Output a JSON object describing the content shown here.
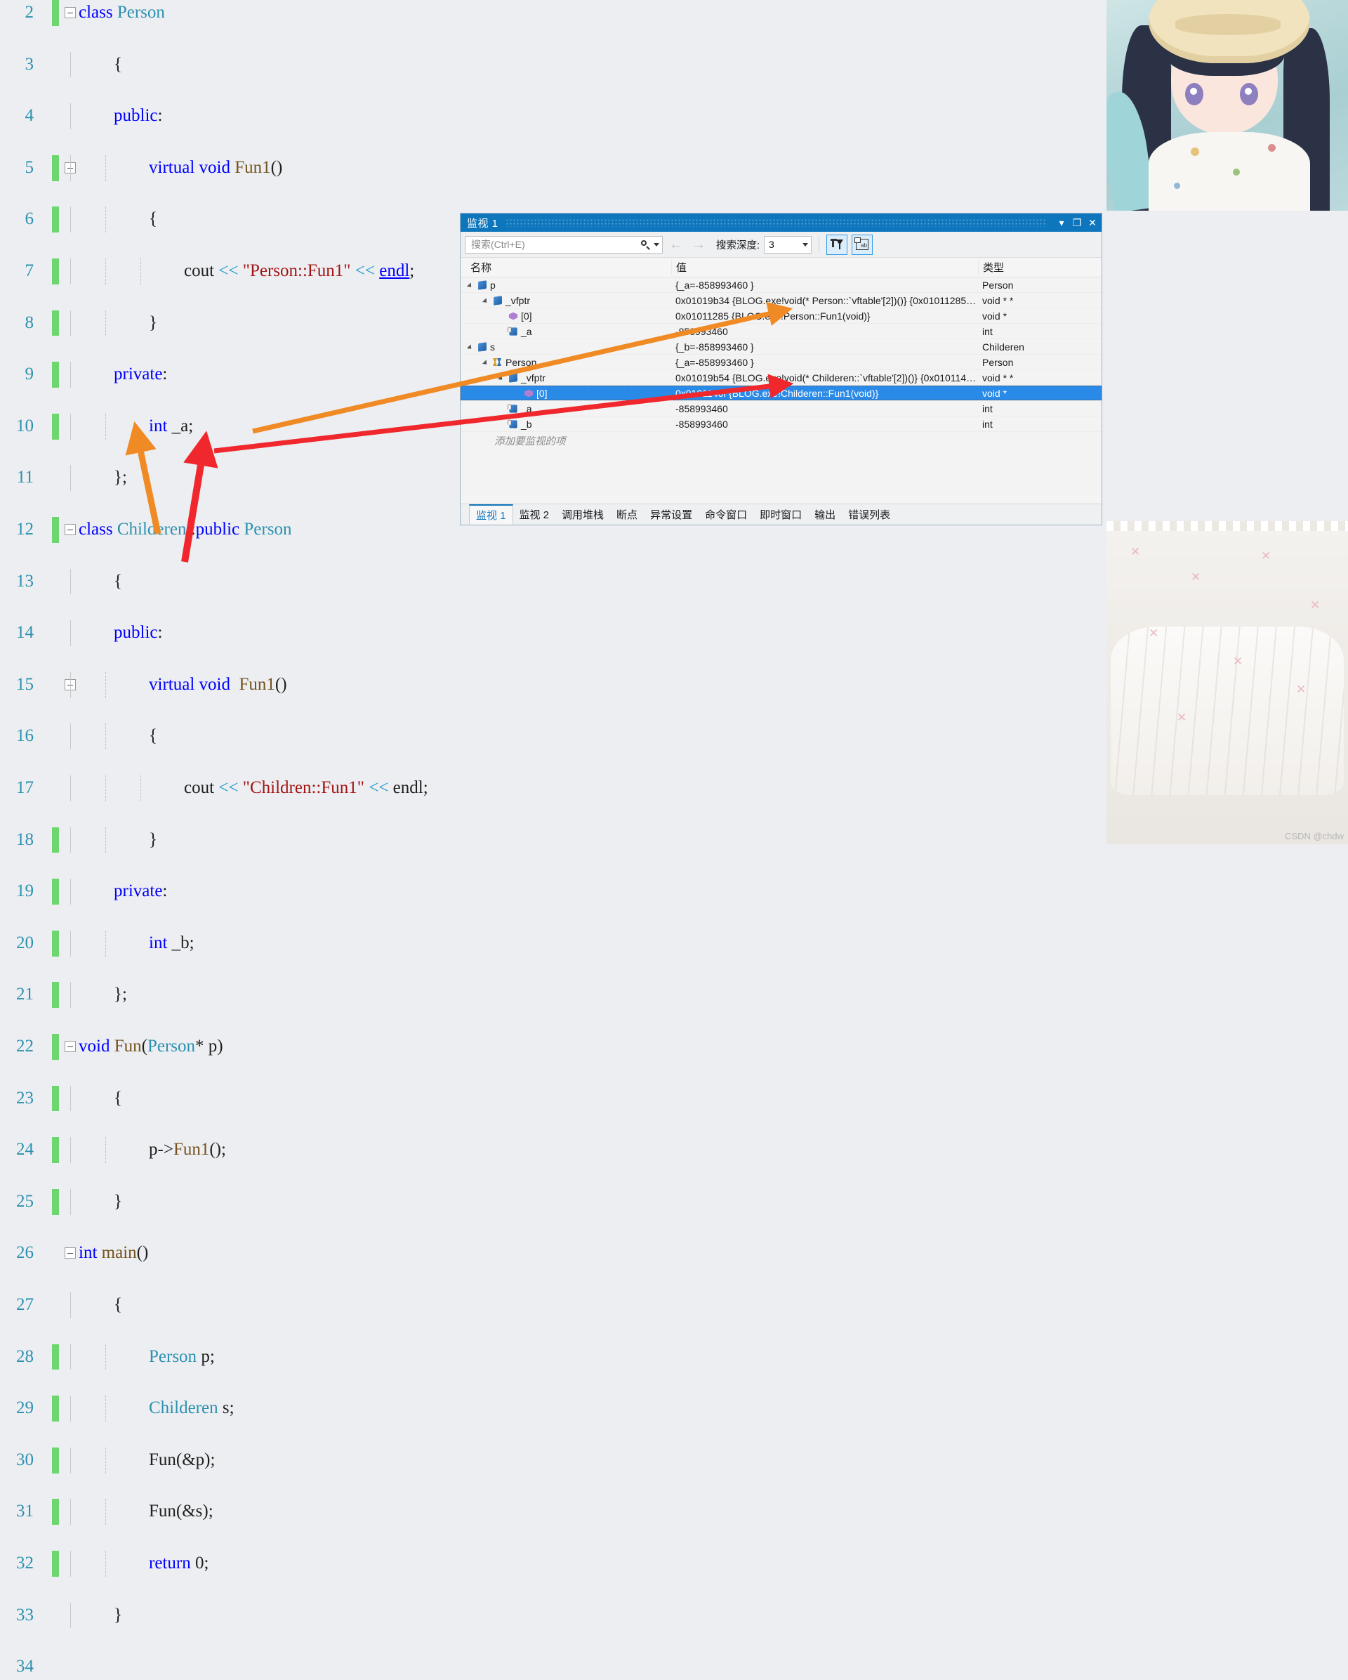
{
  "editor": {
    "first_line_number": 2,
    "lines": [
      {
        "n": 2,
        "fold": true,
        "change": true,
        "indent": 0,
        "tokens": [
          {
            "t": "class ",
            "c": "kw"
          },
          {
            "t": "Person",
            "c": "type"
          }
        ]
      },
      {
        "n": 3,
        "fold": false,
        "change": false,
        "indent": 1,
        "tokens": [
          {
            "t": "{",
            "c": "pl"
          }
        ]
      },
      {
        "n": 4,
        "fold": false,
        "change": false,
        "indent": 1,
        "tokens": [
          {
            "t": "public",
            "c": "kw"
          },
          {
            "t": ":",
            "c": "pl"
          }
        ]
      },
      {
        "n": 5,
        "fold": true,
        "change": true,
        "indent": 2,
        "tokens": [
          {
            "t": "virtual void ",
            "c": "kw"
          },
          {
            "t": "Fun1",
            "c": "fn"
          },
          {
            "t": "()",
            "c": "pl"
          }
        ]
      },
      {
        "n": 6,
        "fold": false,
        "change": true,
        "indent": 2,
        "tokens": [
          {
            "t": "{",
            "c": "pl"
          }
        ]
      },
      {
        "n": 7,
        "fold": false,
        "change": true,
        "indent": 3,
        "tokens": [
          {
            "t": "cout ",
            "c": "ident"
          },
          {
            "t": "<< ",
            "c": "op"
          },
          {
            "t": "\"Person::Fun1\"",
            "c": "str"
          },
          {
            "t": " << ",
            "c": "op"
          },
          {
            "t": "endl",
            "c": "ul"
          },
          {
            "t": ";",
            "c": "pl"
          }
        ]
      },
      {
        "n": 8,
        "fold": false,
        "change": true,
        "indent": 2,
        "tokens": [
          {
            "t": "}",
            "c": "pl"
          }
        ]
      },
      {
        "n": 9,
        "fold": false,
        "change": true,
        "indent": 1,
        "tokens": [
          {
            "t": "private",
            "c": "kw"
          },
          {
            "t": ":",
            "c": "pl"
          }
        ]
      },
      {
        "n": 10,
        "fold": false,
        "change": true,
        "indent": 2,
        "tokens": [
          {
            "t": "int ",
            "c": "kw"
          },
          {
            "t": "_a;",
            "c": "pl"
          }
        ]
      },
      {
        "n": 11,
        "fold": false,
        "change": false,
        "indent": 1,
        "tokens": [
          {
            "t": "};",
            "c": "pl"
          }
        ]
      },
      {
        "n": 12,
        "fold": true,
        "change": true,
        "indent": 0,
        "tokens": [
          {
            "t": "class ",
            "c": "kw"
          },
          {
            "t": "Childeren",
            "c": "type"
          },
          {
            "t": " :",
            "c": "pl"
          },
          {
            "t": "public ",
            "c": "kw"
          },
          {
            "t": "Person",
            "c": "type"
          }
        ]
      },
      {
        "n": 13,
        "fold": false,
        "change": false,
        "indent": 1,
        "tokens": [
          {
            "t": "{",
            "c": "pl"
          }
        ]
      },
      {
        "n": 14,
        "fold": false,
        "change": false,
        "indent": 1,
        "tokens": [
          {
            "t": "public",
            "c": "kw"
          },
          {
            "t": ":",
            "c": "pl"
          }
        ]
      },
      {
        "n": 15,
        "fold": true,
        "change": false,
        "indent": 2,
        "tokens": [
          {
            "t": "virtual void ",
            "c": "kw"
          },
          {
            "t": " Fun1",
            "c": "fn"
          },
          {
            "t": "()",
            "c": "pl"
          }
        ]
      },
      {
        "n": 16,
        "fold": false,
        "change": false,
        "indent": 2,
        "tokens": [
          {
            "t": "{",
            "c": "pl"
          }
        ]
      },
      {
        "n": 17,
        "fold": false,
        "change": false,
        "indent": 3,
        "tokens": [
          {
            "t": "cout ",
            "c": "ident"
          },
          {
            "t": "<< ",
            "c": "op"
          },
          {
            "t": "\"Children::Fun1\"",
            "c": "str"
          },
          {
            "t": " << ",
            "c": "op"
          },
          {
            "t": "endl",
            "c": "ident"
          },
          {
            "t": ";",
            "c": "pl"
          }
        ]
      },
      {
        "n": 18,
        "fold": false,
        "change": true,
        "indent": 2,
        "tokens": [
          {
            "t": "}",
            "c": "pl"
          }
        ]
      },
      {
        "n": 19,
        "fold": false,
        "change": true,
        "indent": 1,
        "tokens": [
          {
            "t": "private",
            "c": "kw"
          },
          {
            "t": ":",
            "c": "pl"
          }
        ]
      },
      {
        "n": 20,
        "fold": false,
        "change": true,
        "indent": 2,
        "tokens": [
          {
            "t": "int ",
            "c": "kw"
          },
          {
            "t": "_b;",
            "c": "pl"
          }
        ]
      },
      {
        "n": 21,
        "fold": false,
        "change": true,
        "indent": 1,
        "tokens": [
          {
            "t": "};",
            "c": "pl"
          }
        ]
      },
      {
        "n": 22,
        "fold": true,
        "change": true,
        "indent": 0,
        "tokens": [
          {
            "t": "void ",
            "c": "kw"
          },
          {
            "t": "Fun",
            "c": "fn"
          },
          {
            "t": "(",
            "c": "pl"
          },
          {
            "t": "Person",
            "c": "type"
          },
          {
            "t": "* ",
            "c": "pl"
          },
          {
            "t": "p)",
            "c": "pl"
          }
        ]
      },
      {
        "n": 23,
        "fold": false,
        "change": true,
        "indent": 1,
        "tokens": [
          {
            "t": "{",
            "c": "pl"
          }
        ]
      },
      {
        "n": 24,
        "fold": false,
        "change": true,
        "indent": 2,
        "tokens": [
          {
            "t": "p->",
            "c": "ident"
          },
          {
            "t": "Fun1",
            "c": "fn"
          },
          {
            "t": "();",
            "c": "pl"
          }
        ]
      },
      {
        "n": 25,
        "fold": false,
        "change": true,
        "indent": 1,
        "tokens": [
          {
            "t": "}",
            "c": "pl"
          }
        ]
      },
      {
        "n": 26,
        "fold": true,
        "change": false,
        "indent": 0,
        "tokens": [
          {
            "t": "int ",
            "c": "kw"
          },
          {
            "t": "main",
            "c": "fn"
          },
          {
            "t": "()",
            "c": "pl"
          }
        ]
      },
      {
        "n": 27,
        "fold": false,
        "change": false,
        "indent": 1,
        "tokens": [
          {
            "t": "{",
            "c": "pl"
          }
        ]
      },
      {
        "n": 28,
        "fold": false,
        "change": true,
        "indent": 2,
        "tokens": [
          {
            "t": "Person",
            "c": "type"
          },
          {
            "t": " p;",
            "c": "pl"
          }
        ]
      },
      {
        "n": 29,
        "fold": false,
        "change": true,
        "indent": 2,
        "tokens": [
          {
            "t": "Childeren",
            "c": "type"
          },
          {
            "t": " s;",
            "c": "pl"
          }
        ]
      },
      {
        "n": 30,
        "fold": false,
        "change": true,
        "indent": 2,
        "tokens": [
          {
            "t": "Fun",
            "c": "ident"
          },
          {
            "t": "(&p);",
            "c": "pl"
          }
        ]
      },
      {
        "n": 31,
        "fold": false,
        "change": true,
        "indent": 2,
        "tokens": [
          {
            "t": "Fun",
            "c": "ident"
          },
          {
            "t": "(&s);",
            "c": "pl"
          }
        ]
      },
      {
        "n": 32,
        "fold": false,
        "change": true,
        "indent": 2,
        "tokens": [
          {
            "t": "return ",
            "c": "kw"
          },
          {
            "t": "0;",
            "c": "pl"
          }
        ]
      },
      {
        "n": 33,
        "fold": false,
        "change": false,
        "indent": 1,
        "tokens": [
          {
            "t": "}",
            "c": "pl"
          }
        ]
      },
      {
        "n": 34,
        "fold": false,
        "change": false,
        "indent": 0,
        "tokens": []
      }
    ]
  },
  "watch": {
    "title": "监视 1",
    "window_buttons": {
      "dropdown": "▾",
      "maximize": "❐",
      "close": "✕"
    },
    "toolbar": {
      "search_placeholder": "搜索(Ctrl+E)",
      "search_value": "",
      "search_icon": "search-icon",
      "back_arrow": "←",
      "forward_arrow": "→",
      "depth_label": "搜索深度:",
      "depth_value": "3",
      "pin_button": "pin-filter-icon",
      "hex_button": "hex-display-icon"
    },
    "columns": {
      "name": "名称",
      "value": "值",
      "type": "类型"
    },
    "rows": [
      {
        "indent": 0,
        "expander": "open",
        "icon": "field-icon",
        "name": "p",
        "value": "{_a=-858993460 }",
        "type": "Person",
        "selected": false
      },
      {
        "indent": 1,
        "expander": "open",
        "icon": "field-icon",
        "name": "_vfptr",
        "value": "0x01019b34 {BLOG.exe!void(* Person::`vftable'[2])()} {0x01011285 {...",
        "type": "void * *",
        "selected": false
      },
      {
        "indent": 2,
        "expander": "none",
        "icon": "element-icon",
        "name": "[0]",
        "value": "0x01011285 {BLOG.exe!Person::Fun1(void)}",
        "type": "void *",
        "selected": false
      },
      {
        "indent": 2,
        "expander": "none",
        "icon": "private-field-icon",
        "name": "_a",
        "value": "-858993460",
        "type": "int",
        "selected": false
      },
      {
        "indent": 0,
        "expander": "open",
        "icon": "field-icon",
        "name": "s",
        "value": "{_b=-858993460 }",
        "type": "Childeren",
        "selected": false
      },
      {
        "indent": 1,
        "expander": "open",
        "icon": "base-class-icon",
        "name": "Person",
        "value": "{_a=-858993460 }",
        "type": "Person",
        "selected": false
      },
      {
        "indent": 2,
        "expander": "open",
        "icon": "field-icon",
        "name": "_vfptr",
        "value": "0x01019b54 {BLOG.exe!void(* Childeren::`vftable'[2])()} {0x0101146...",
        "type": "void * *",
        "selected": false
      },
      {
        "indent": 3,
        "expander": "none",
        "icon": "element-icon",
        "name": "[0]",
        "value": "0x0101146f {BLOG.exe!Childeren::Fun1(void)}",
        "type": "void *",
        "selected": true
      },
      {
        "indent": 2,
        "expander": "none",
        "icon": "private-field-icon",
        "name": "_a",
        "value": "-858993460",
        "type": "int",
        "selected": false
      },
      {
        "indent": 2,
        "expander": "none",
        "icon": "private-field-icon",
        "name": "_b",
        "value": "-858993460",
        "type": "int",
        "selected": false
      }
    ],
    "add_row_placeholder": "添加要监视的项",
    "tabs": [
      {
        "label": "监视 1",
        "active": true
      },
      {
        "label": "监视 2",
        "active": false
      },
      {
        "label": "调用堆栈",
        "active": false
      },
      {
        "label": "断点",
        "active": false
      },
      {
        "label": "异常设置",
        "active": false
      },
      {
        "label": "命令窗口",
        "active": false
      },
      {
        "label": "即时窗口",
        "active": false
      },
      {
        "label": "输出",
        "active": false
      },
      {
        "label": "错误列表",
        "active": false
      }
    ]
  },
  "annotations": {
    "orange_arrow": "orange-arrow-p-to-vtable",
    "red_arrow": "red-arrow-s-to-vtable"
  },
  "wallpaper": {
    "watermark": "CSDN @chdw"
  },
  "colors": {
    "title_blue": "#0e76bc",
    "selection_blue": "#2a8ae8",
    "change_green": "#6ed66e",
    "orange_arrow": "#f08a24",
    "red_arrow": "#f0282d",
    "keyword_blue": "#0000ff",
    "type_teal": "#2b91af",
    "string_red": "#a31515",
    "function_brown": "#74531f"
  }
}
